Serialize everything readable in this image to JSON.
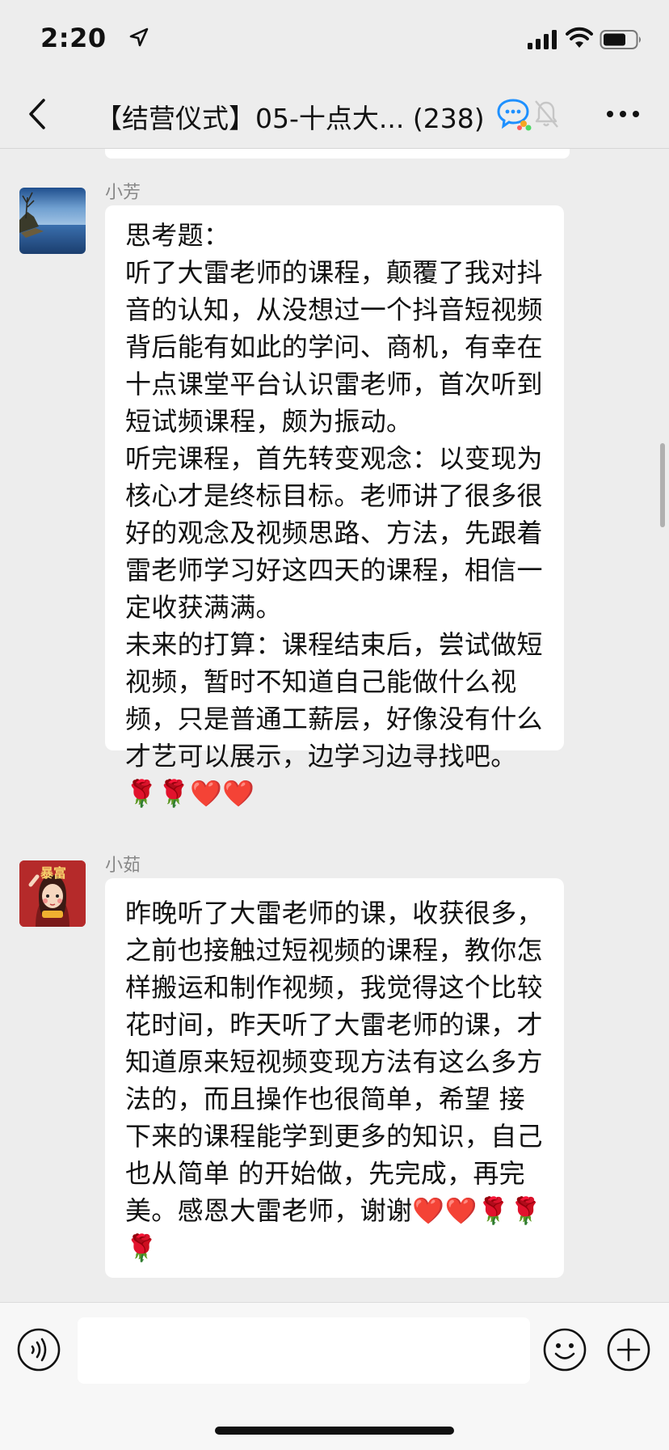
{
  "status_bar": {
    "time": "2:20",
    "icons": [
      "location-arrow-icon",
      "cellular-signal-icon",
      "wifi-icon",
      "battery-icon"
    ]
  },
  "nav": {
    "title": "【结营仪式】05-十点大... (238)",
    "icons": [
      "back-chevron-icon",
      "chat-bubble-icon",
      "mute-bell-icon",
      "more-dots-icon"
    ]
  },
  "messages": [
    {
      "sender": "小芳",
      "avatar": "lake-landscape-avatar",
      "text": "思考题：\n听了大雷老师的课程，颠覆了我对抖音的认知，从没想过一个抖音短视频背后能有如此的学问、商机，有幸在十点课堂平台认识雷老师，首次听到短试频课程，颇为振动。\n听完课程，首先转变观念：以变现为核心才是终标目标。老师讲了很多很好的观念及视频思路、方法，先跟着雷老师学习好这四天的课程，相信一定收获满满。\n未来的打算：课程结束后，尝试做短视频，暂时不知道自己能做什么视频，只是普通工薪层，好像没有什么才艺可以展示，边学习边寻找吧。🌹🌹❤️❤️"
    },
    {
      "sender": "小茹",
      "avatar": "cartoon-girl-avatar",
      "avatar_text": "暴富",
      "text": "昨晚听了大雷老师的课，收获很多，之前也接触过短视频的课程，教你怎样搬运和制作视频，我觉得这个比较花时间，昨天听了大雷老师的课，才知道原来短视频变现方法有这么多方法的，而且操作也很简单，希望 接下来的课程能学到更多的知识，自己也从简单 的开始做，先完成，再完美。感恩大雷老师，谢谢❤️❤️🌹🌹🌹"
    }
  ],
  "input_bar": {
    "text_value": "",
    "icons": [
      "voice-icon",
      "emoji-icon",
      "plus-icon"
    ]
  },
  "colors": {
    "background": "#ededed",
    "bubble": "#ffffff",
    "sender_text": "#888888",
    "avatar_red": "#b52a2a"
  }
}
